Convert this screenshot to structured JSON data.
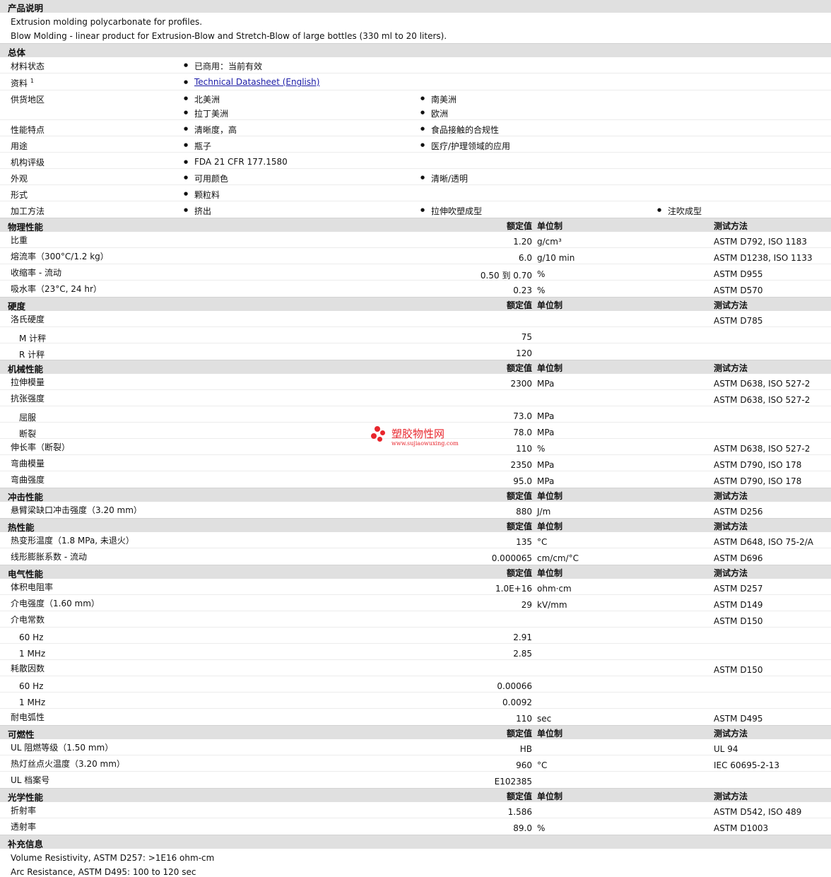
{
  "product_desc": {
    "title": "产品说明",
    "lines": [
      "Extrusion molding polycarbonate for profiles.",
      "Blow Molding - linear product for Extrusion-Blow and Stretch-Blow of large bottles (330 ml to 20 liters)."
    ]
  },
  "general": {
    "title": "总体",
    "status_label": "材料状态",
    "status_value": "已商用：当前有效",
    "docs_label": "资料",
    "docs_sup": "1",
    "docs_link": "Technical Datasheet (English)",
    "region_label": "供货地区",
    "region_1": "北美洲",
    "region_2": "南美洲",
    "region_3": "拉丁美洲",
    "region_4": "欧洲",
    "features_label": "性能特点",
    "features_1": "清晰度，高",
    "features_2": "食品接触的合规性",
    "uses_label": "用途",
    "uses_1": "瓶子",
    "uses_2": "医疗/护理领域的应用",
    "agency_label": "机构评级",
    "agency_1": "FDA 21 CFR 177.1580",
    "appearance_label": "外观",
    "appearance_1": "可用颜色",
    "appearance_2": "清晰/透明",
    "form_label": "形式",
    "form_1": "颗粒料",
    "processing_label": "加工方法",
    "processing_1": "挤出",
    "processing_2": "拉伸吹塑成型",
    "processing_3": "注吹成型"
  },
  "headers": {
    "value": "额定值",
    "unit": "单位制",
    "method": "测试方法"
  },
  "physical": {
    "title": "物理性能",
    "rows": [
      {
        "label": "比重",
        "value": "1.20",
        "unit": "g/cm³",
        "method": "ASTM D792, ISO 1183"
      },
      {
        "label": "熔流率（300°C/1.2 kg）",
        "value": "6.0",
        "unit": "g/10 min",
        "method": "ASTM D1238, ISO 1133"
      },
      {
        "label": "收缩率 - 流动",
        "value": "0.50 到 0.70",
        "unit": "%",
        "method": "ASTM D955"
      },
      {
        "label": "吸水率（23°C, 24 hr）",
        "value": "0.23",
        "unit": "%",
        "method": "ASTM D570"
      }
    ]
  },
  "hardness": {
    "title": "硬度",
    "rows": [
      {
        "label": "洛氏硬度",
        "value": "",
        "unit": "",
        "method": "ASTM D785"
      },
      {
        "label": "M 计秤",
        "value": "75",
        "unit": "",
        "method": ""
      },
      {
        "label": "R 计秤",
        "value": "120",
        "unit": "",
        "method": ""
      }
    ]
  },
  "mechanical": {
    "title": "机械性能",
    "rows": [
      {
        "label": "拉伸模量",
        "value": "2300",
        "unit": "MPa",
        "method": "ASTM D638, ISO 527-2"
      },
      {
        "label": "抗张强度",
        "value": "",
        "unit": "",
        "method": "ASTM D638, ISO 527-2"
      },
      {
        "label": "屈服",
        "value": "73.0",
        "unit": "MPa",
        "method": ""
      },
      {
        "label": "断裂",
        "value": "78.0",
        "unit": "MPa",
        "method": ""
      },
      {
        "label": "伸长率（断裂）",
        "value": "110",
        "unit": "%",
        "method": "ASTM D638, ISO 527-2"
      },
      {
        "label": "弯曲模量",
        "value": "2350",
        "unit": "MPa",
        "method": "ASTM D790, ISO 178"
      },
      {
        "label": "弯曲强度",
        "value": "95.0",
        "unit": "MPa",
        "method": "ASTM D790, ISO 178"
      }
    ]
  },
  "impact": {
    "title": "冲击性能",
    "rows": [
      {
        "label": "悬臂梁缺口冲击强度（3.20 mm）",
        "value": "880",
        "unit": "J/m",
        "method": "ASTM D256"
      }
    ]
  },
  "thermal": {
    "title": "热性能",
    "rows": [
      {
        "label": "热变形温度（1.8 MPa, 未退火）",
        "value": "135",
        "unit": "°C",
        "method": "ASTM D648, ISO 75-2/A"
      },
      {
        "label": "线形膨胀系数 - 流动",
        "value": "0.000065",
        "unit": "cm/cm/°C",
        "method": "ASTM D696"
      }
    ]
  },
  "electrical": {
    "title": "电气性能",
    "rows": [
      {
        "label": "体积电阻率",
        "value": "1.0E+16",
        "unit": "ohm·cm",
        "method": "ASTM D257"
      },
      {
        "label": "介电强度（1.60 mm）",
        "value": "29",
        "unit": "kV/mm",
        "method": "ASTM D149"
      },
      {
        "label": "介电常数",
        "value": "",
        "unit": "",
        "method": "ASTM D150"
      },
      {
        "label": "60 Hz",
        "value": "2.91",
        "unit": "",
        "method": ""
      },
      {
        "label": "1 MHz",
        "value": "2.85",
        "unit": "",
        "method": ""
      },
      {
        "label": "耗散因数",
        "value": "",
        "unit": "",
        "method": "ASTM D150"
      },
      {
        "label": "60 Hz",
        "value": "0.00066",
        "unit": "",
        "method": ""
      },
      {
        "label": "1 MHz",
        "value": "0.0092",
        "unit": "",
        "method": ""
      },
      {
        "label": "耐电弧性",
        "value": "110",
        "unit": "sec",
        "method": "ASTM D495"
      }
    ]
  },
  "flammability": {
    "title": "可燃性",
    "rows": [
      {
        "label": "UL 阻燃等级（1.50 mm）",
        "value": "HB",
        "unit": "",
        "method": "UL 94"
      },
      {
        "label": "热灯丝点火温度（3.20 mm）",
        "value": "960",
        "unit": "°C",
        "method": "IEC 60695-2-13"
      },
      {
        "label": "UL 档案号",
        "value": "E102385",
        "unit": "",
        "method": ""
      }
    ]
  },
  "optical": {
    "title": "光学性能",
    "rows": [
      {
        "label": "折射率",
        "value": "1.586",
        "unit": "",
        "method": "ASTM D542, ISO 489"
      },
      {
        "label": "透射率",
        "value": "89.0",
        "unit": "%",
        "method": "ASTM D1003"
      }
    ]
  },
  "supplement": {
    "title": "补充信息",
    "lines": [
      "Volume Resistivity, ASTM D257: >1E16 ohm-cm",
      "Arc Resistance, ASTM D495: 100 to 120 sec"
    ]
  },
  "watermark": {
    "cn": "塑胶物性网",
    "url": "www.sujiaowuxing.com"
  }
}
